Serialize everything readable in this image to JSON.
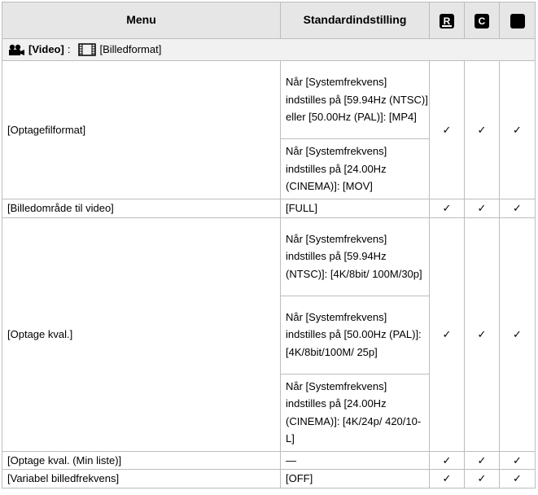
{
  "header": {
    "menu": "Menu",
    "default": "Standardindstilling",
    "col1_icon": "R",
    "col2_icon": "C",
    "col3_icon": ""
  },
  "section": {
    "video": "[Video]",
    "sep": ":",
    "format": "[Billedformat]"
  },
  "rows": {
    "file_format": {
      "menu": "[Optagefilformat]",
      "opt1": "Når [Systemfrekvens] indstilles på [59.94Hz (NTSC)] eller [50.00Hz (PAL)]: [MP4]",
      "opt2": "Når [Systemfrekvens] indstilles på [24.00Hz (CINEMA)]: [MOV]"
    },
    "image_area": {
      "menu": "[Billedområde til video]",
      "default": "[FULL]"
    },
    "rec_quality": {
      "menu": "[Optage kval.]",
      "opt1": "Når [Systemfrekvens] indstilles på [59.94Hz (NTSC)]: [4K/8bit/ 100M/30p]",
      "opt2": "Når [Systemfrekvens] indstilles på [50.00Hz (PAL)]: [4K/8bit/100M/ 25p]",
      "opt3": "Når [Systemfrekvens] indstilles på [24.00Hz (CINEMA)]: [4K/24p/ 420/10-L]"
    },
    "rec_quality_list": {
      "menu": "[Optage kval. (Min liste)]",
      "default": "—"
    },
    "variable_frame": {
      "menu": "[Variabel billedfrekvens]",
      "default": "[OFF]"
    }
  },
  "check": "✓"
}
